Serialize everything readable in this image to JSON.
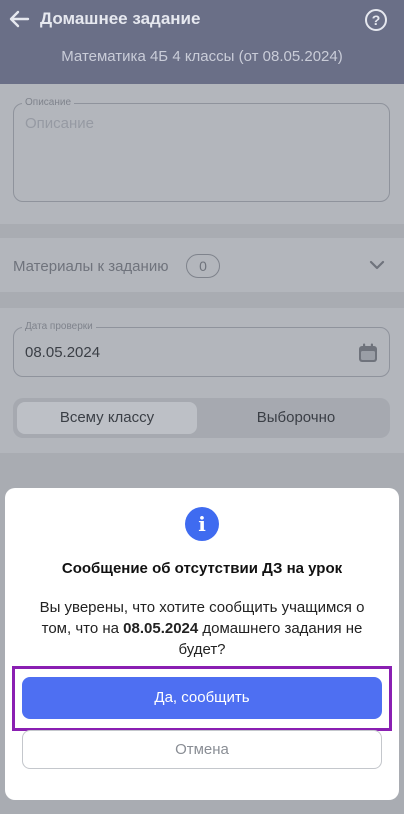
{
  "header": {
    "title": "Домашнее задание",
    "subtitle": "Математика 4Б 4 классы (от 08.05.2024)",
    "help_glyph": "?"
  },
  "description": {
    "label": "Описание",
    "placeholder": "Описание"
  },
  "materials": {
    "label": "Материалы к заданию",
    "count": "0"
  },
  "check_date": {
    "label": "Дата проверки",
    "value": "08.05.2024"
  },
  "target": {
    "option_all": "Всему классу",
    "option_selective": "Выборочно"
  },
  "dialog": {
    "icon": "info-icon",
    "title": "Сообщение об отсутствии ДЗ на урок",
    "text_before": "Вы уверены, что хотите сообщить учащимся о том, что на ",
    "text_date": "08.05.2024",
    "text_after": " домашнего задания не будет?",
    "confirm_label": "Да, сообщить",
    "cancel_label": "Отмена"
  },
  "colors": {
    "accent": "#4e6ff2",
    "highlight": "#8a1fb2",
    "header_bg": "#6a6f87"
  }
}
